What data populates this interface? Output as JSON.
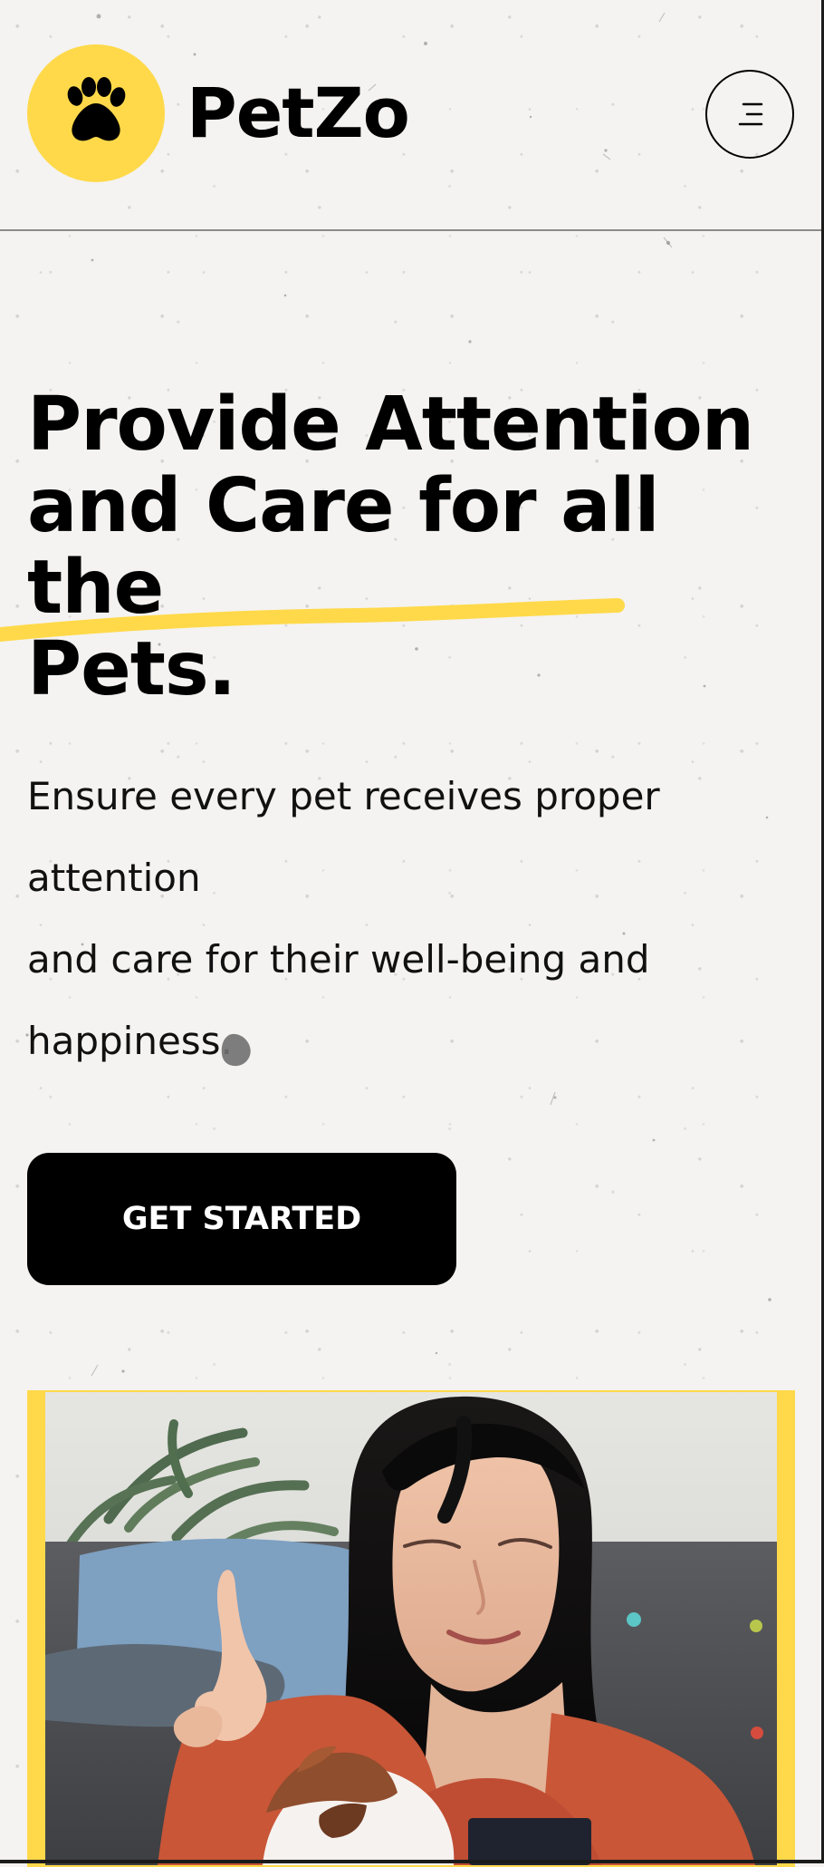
{
  "brand": {
    "name": "PetZo",
    "logo_icon": "paw-icon",
    "accent_color": "#ffd94a"
  },
  "header": {
    "menu_icon": "menu-icon"
  },
  "hero": {
    "title_lines": [
      "Provide Attention",
      "and Care for all the",
      "Pets."
    ],
    "description_lines": [
      "Ensure every pet receives proper attention",
      "and care for their well-being and",
      "happiness."
    ],
    "cta_label": "GET STARTED"
  },
  "colors": {
    "background": "#f4f3f1",
    "text": "#000000",
    "button": "#000000",
    "button_text": "#ffffff",
    "highlight": "#ffd94a"
  }
}
